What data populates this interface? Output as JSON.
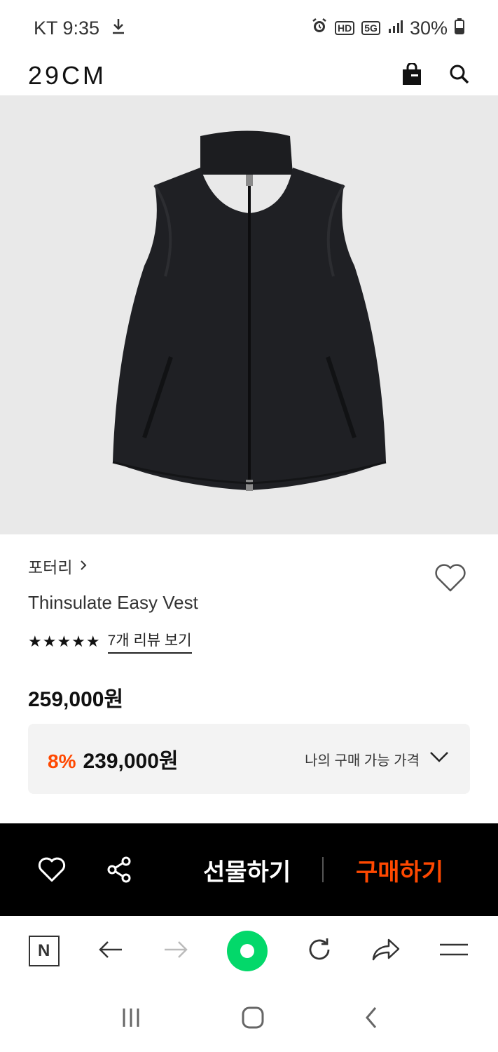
{
  "status_bar": {
    "carrier_time": "KT 9:35",
    "hd": "HD",
    "net": "5G",
    "battery": "30%"
  },
  "header": {
    "logo": "29CM"
  },
  "product": {
    "brand": "포터리",
    "name": "Thinsulate Easy Vest",
    "rating_stars": "★★★★★",
    "review_link": "7개 리뷰 보기",
    "price": "259,000원",
    "discount": "8%",
    "sale_price": "239,000원",
    "my_price_label": "나의 구매 가능 가격"
  },
  "action_bar": {
    "gift_label": "선물하기",
    "buy_label": "구매하기"
  },
  "browser_bar": {
    "n_label": "N"
  },
  "colors": {
    "accent": "#ff4800",
    "green": "#03d86a"
  }
}
